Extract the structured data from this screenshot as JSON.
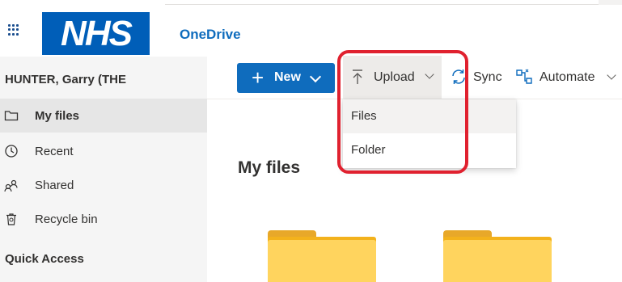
{
  "header": {
    "logo_text": "NHS",
    "app_name": "OneDrive",
    "waffle_icon": "app-launcher-icon"
  },
  "sidebar": {
    "user_name": "HUNTER, Garry (THE",
    "items": [
      {
        "label": "My files",
        "icon": "folder-icon",
        "selected": true
      },
      {
        "label": "Recent",
        "icon": "clock-icon",
        "selected": false
      },
      {
        "label": "Shared",
        "icon": "people-icon",
        "selected": false
      },
      {
        "label": "Recycle bin",
        "icon": "trash-icon",
        "selected": false
      }
    ],
    "quick_access_label": "Quick Access"
  },
  "toolbar": {
    "new_label": "New",
    "upload_label": "Upload",
    "sync_label": "Sync",
    "automate_label": "Automate"
  },
  "upload_menu": {
    "items": [
      {
        "label": "Files"
      },
      {
        "label": "Folder"
      }
    ]
  },
  "main": {
    "title": "My files"
  },
  "colors": {
    "accent": "#0f6cbd",
    "nhs_blue": "#005eb8",
    "highlight": "#e0212f",
    "folder": "#ffd45e"
  }
}
